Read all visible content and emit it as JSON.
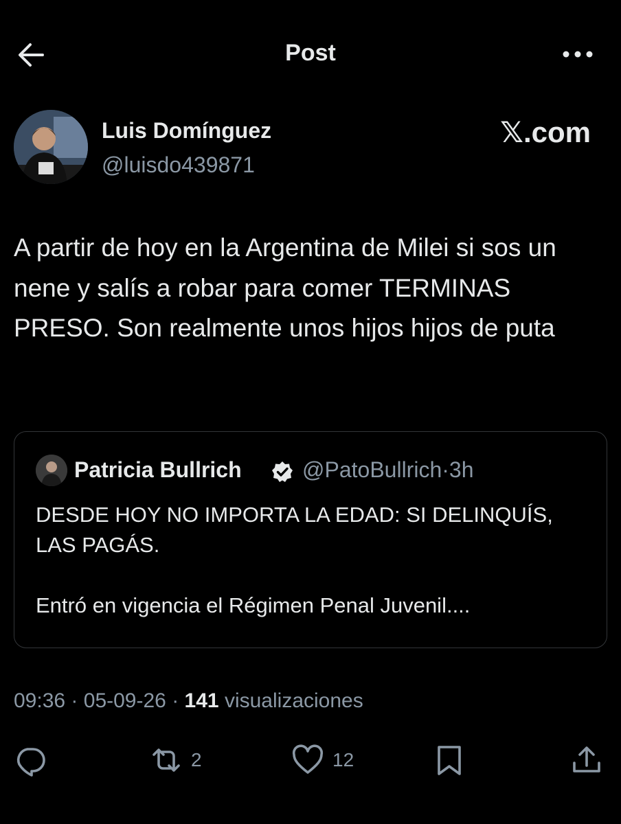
{
  "header": {
    "title": "Post",
    "back_icon": "arrow-left-icon",
    "more_icon": "more-horizontal-icon"
  },
  "author": {
    "display_name": "Luis Domínguez",
    "handle": "@luisdo439871",
    "avatar_icon": "user-avatar-photo"
  },
  "watermark": "𝕏.com",
  "tweet": {
    "text": "A partir de hoy en la Argentina de Milei si sos un nene y salís a robar para comer TERMINAS PRESO. Son realmente unos hijos hijos de puta"
  },
  "quote": {
    "display_name": "Patricia Bullrich",
    "verified_icon": "verified-badge-icon",
    "handle": "@PatoBullrich",
    "separator": "·",
    "time": "3h",
    "line1": "DESDE HOY NO IMPORTA LA EDAD: SI DELINQUÍS, LAS PAGÁS.",
    "line2": "Entró en vigencia el Régimen Penal Juvenil...."
  },
  "meta": {
    "time": "09:36",
    "date": "05-09-26",
    "sep": "·",
    "views_count": "141",
    "views_label": "visualizaciones"
  },
  "actions": {
    "reply_icon": "reply-icon",
    "repost_icon": "repost-icon",
    "repost_count": "2",
    "like_icon": "heart-icon",
    "like_count": "12",
    "bookmark_icon": "bookmark-icon",
    "share_icon": "share-icon"
  },
  "colors": {
    "background": "#000000",
    "primary_text": "#e7e9ea",
    "secondary_text": "#8b98a5",
    "border": "#333639",
    "verified_badge": "#e7e9ea"
  }
}
